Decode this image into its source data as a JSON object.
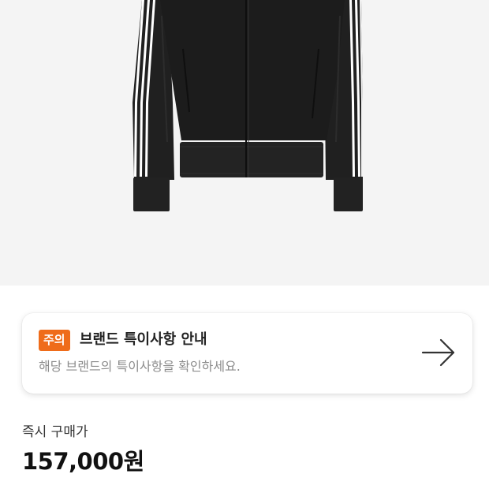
{
  "product": {
    "image_alt": "black track jacket with three white stripes"
  },
  "notice": {
    "badge": "주의",
    "title": "브랜드 특이사항 안내",
    "description": "해당 브랜드의 특이사항을 확인하세요.",
    "icon": "arrow-right-icon",
    "badge_color": "#ef6c1a"
  },
  "price": {
    "label": "즉시 구매가",
    "value": "157,000원"
  }
}
